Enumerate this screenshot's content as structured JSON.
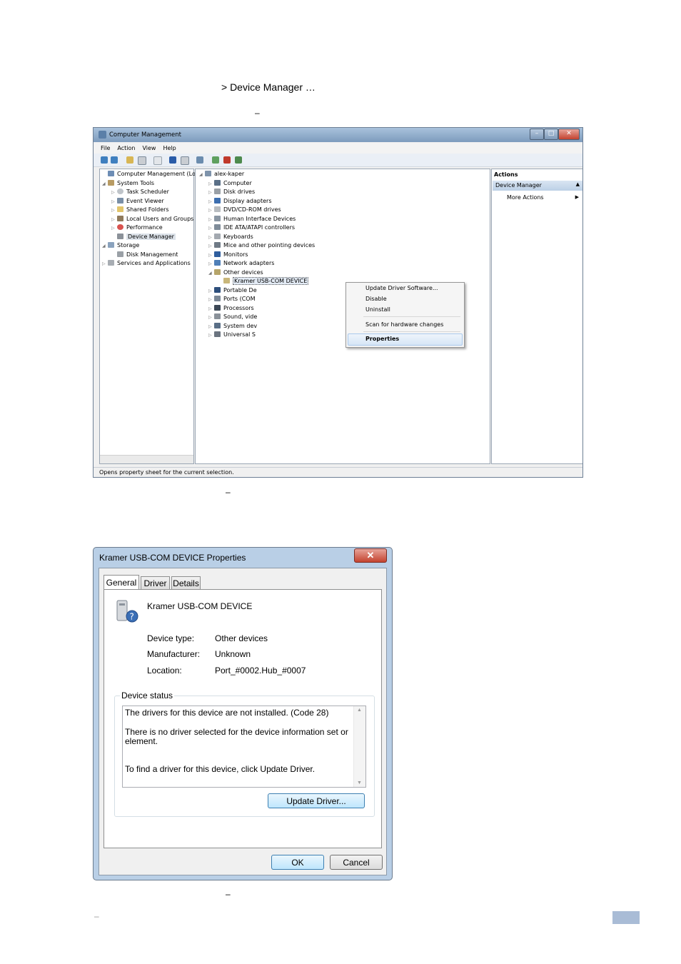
{
  "doc": {
    "line1": "> Device Manager …",
    "dash1": "–",
    "dash2": "–",
    "dash3": "–",
    "dash4": "–"
  },
  "computer_management": {
    "title": "Computer Management",
    "menu": [
      "File",
      "Action",
      "View",
      "Help"
    ],
    "left_tree": [
      {
        "label": "Computer Management (Local",
        "icon": "computer-management-icon"
      },
      {
        "label": "System Tools",
        "icon": "tools-icon"
      },
      {
        "label": "Task Scheduler",
        "icon": "clock-icon"
      },
      {
        "label": "Event Viewer",
        "icon": "event-viewer-icon"
      },
      {
        "label": "Shared Folders",
        "icon": "folder-icon"
      },
      {
        "label": "Local Users and Groups",
        "icon": "users-icon"
      },
      {
        "label": "Performance",
        "icon": "performance-icon"
      },
      {
        "label": "Device Manager",
        "icon": "device-manager-icon"
      },
      {
        "label": "Storage",
        "icon": "storage-icon"
      },
      {
        "label": "Disk Management",
        "icon": "disk-icon"
      },
      {
        "label": "Services and Applications",
        "icon": "services-icon"
      }
    ],
    "device_tree": [
      {
        "label": "alex-kaper",
        "icon": "computer-icon"
      },
      {
        "label": "Computer",
        "icon": "computer-icon"
      },
      {
        "label": "Disk drives",
        "icon": "disk-drive-icon"
      },
      {
        "label": "Display adapters",
        "icon": "display-icon"
      },
      {
        "label": "DVD/CD-ROM drives",
        "icon": "dvd-icon"
      },
      {
        "label": "Human Interface Devices",
        "icon": "hid-icon"
      },
      {
        "label": "IDE ATA/ATAPI controllers",
        "icon": "ide-icon"
      },
      {
        "label": "Keyboards",
        "icon": "keyboard-icon"
      },
      {
        "label": "Mice and other pointing devices",
        "icon": "mouse-icon"
      },
      {
        "label": "Monitors",
        "icon": "monitor-icon"
      },
      {
        "label": "Network adapters",
        "icon": "network-icon"
      },
      {
        "label": "Other devices",
        "icon": "other-devices-icon"
      },
      {
        "label": "Kramer USB-COM DEVICE",
        "icon": "unknown-device-icon"
      },
      {
        "label": "Portable De",
        "icon": "portable-icon"
      },
      {
        "label": "Ports (COM",
        "icon": "port-icon"
      },
      {
        "label": "Processors",
        "icon": "processor-icon"
      },
      {
        "label": "Sound, vide",
        "icon": "sound-icon"
      },
      {
        "label": "System dev",
        "icon": "system-icon"
      },
      {
        "label": "Universal S",
        "icon": "usb-icon"
      }
    ],
    "context_menu": {
      "update": "Update Driver Software...",
      "disable": "Disable",
      "uninstall": "Uninstall",
      "scan": "Scan for hardware changes",
      "properties": "Properties"
    },
    "actions": {
      "header": "Actions",
      "selected": "Device Manager",
      "more": "More Actions"
    },
    "status": "Opens property sheet for the current selection."
  },
  "properties_dialog": {
    "title": "Kramer USB-COM DEVICE Properties",
    "tabs": [
      "General",
      "Driver",
      "Details"
    ],
    "device_name": "Kramer USB-COM DEVICE",
    "device_type_label": "Device type:",
    "device_type_value": "Other devices",
    "manufacturer_label": "Manufacturer:",
    "manufacturer_value": "Unknown",
    "location_label": "Location:",
    "location_value": "Port_#0002.Hub_#0007",
    "status_caption": "Device status",
    "status_line1": "The drivers for this device are not installed. (Code 28)",
    "status_line2": "There is no driver selected for the device information set or",
    "status_line3": "element.",
    "status_line4": "To find a driver for this device, click Update Driver.",
    "update_button": "Update Driver...",
    "ok": "OK",
    "cancel": "Cancel"
  }
}
